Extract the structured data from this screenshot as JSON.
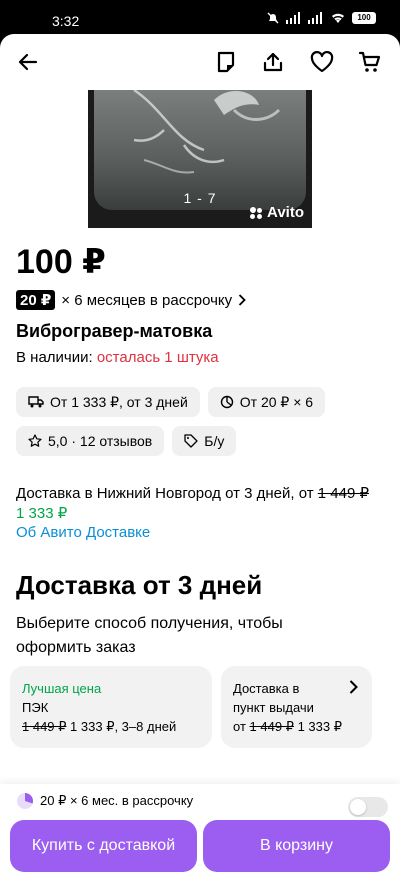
{
  "status": {
    "time": "3:32",
    "battery": "100"
  },
  "gallery": {
    "counter": "1 - 7",
    "watermark": "Avito"
  },
  "product": {
    "price": "100 ₽",
    "installment_tag": "20 ₽",
    "installment_text": "× 6 месяцев в рассрочку",
    "title": "Виброгравер-матовка",
    "availability_label": "В наличии:",
    "availability_value": "осталась 1 штука"
  },
  "chips": [
    {
      "label": "От 1 333 ₽, от 3 дней",
      "icon": "truck-icon"
    },
    {
      "label": "От 20 ₽ × 6",
      "icon": "pie-icon"
    },
    {
      "label": "5,0 · 12 отзывов",
      "icon": "star-icon"
    },
    {
      "label": "Б/у",
      "icon": "tag-icon"
    }
  ],
  "delivery_info": {
    "text": "Доставка в Нижний Новгород от 3 дней, от",
    "old_price": "1 449 ₽",
    "new_price": "1 333 ₽",
    "link": "Об Авито Доставке"
  },
  "delivery_section": {
    "heading": "Доставка от 3 дней",
    "subtitle": "Выберите способ получения, чтобы оформить заказ",
    "options": [
      {
        "badge": "Лучшая цена",
        "carrier": "ПЭК",
        "old_price": "1 449 ₽",
        "new_price": "1 333 ₽, 3–8 дней"
      },
      {
        "title": "Доставка в пункт выдачи",
        "prefix": "от",
        "old_price": "1 449 ₽",
        "new_price": "1 333 ₽"
      }
    ]
  },
  "footer": {
    "installment": "20 ₽ × 6 мес. в рассрочку",
    "buy_button": "Купить с доставкой",
    "cart_button": "В корзину"
  },
  "colors": {
    "accent": "#9b5ef0",
    "red": "#e0313f",
    "green": "#02a44b",
    "link": "#0a8fd6"
  }
}
